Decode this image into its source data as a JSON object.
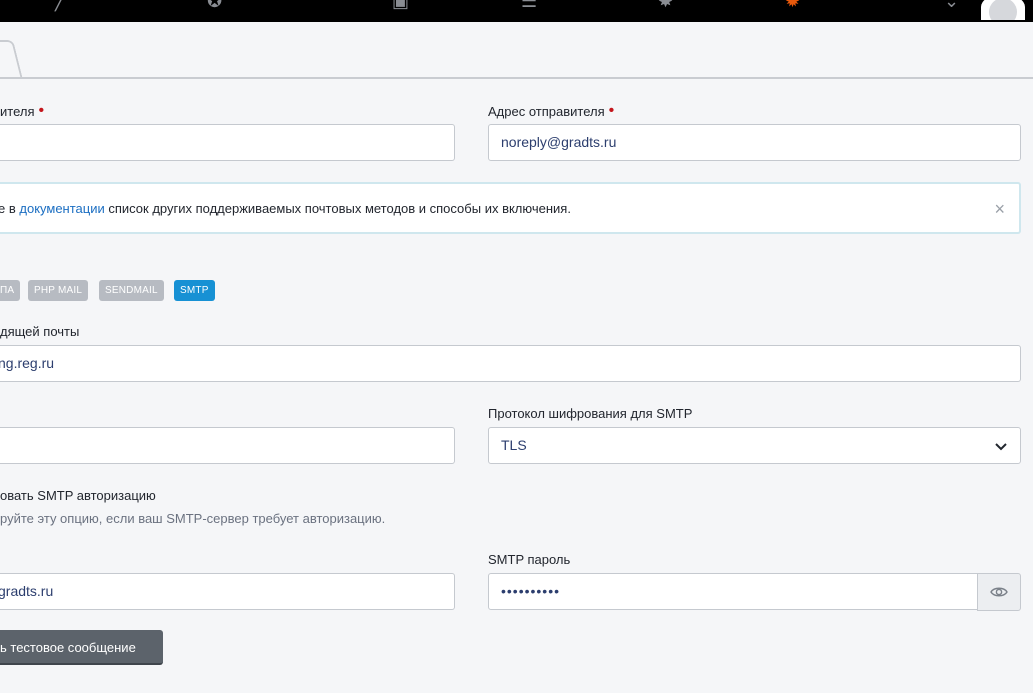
{
  "header": {
    "icons": [
      "back-icon",
      "rocket-icon",
      "calendar-icon",
      "list-icon",
      "puzzle-icon",
      "gear-icon",
      "user-avatar"
    ],
    "active_icon_color": "#e8590c"
  },
  "form": {
    "sender_name": {
      "label": "ителя",
      "value": ""
    },
    "sender_email": {
      "label": "Адрес отправителя",
      "value": "noreply@gradts.ru"
    },
    "alert": {
      "prefix": "е в ",
      "link": "документации",
      "suffix": " список других поддерживаемых почтовых методов и способы их включения.",
      "close": "×"
    },
    "mail_methods": [
      "ПА",
      "PHP MAIL",
      "SENDMAIL",
      "SMTP"
    ],
    "active_method": "SMTP",
    "smtp_host": {
      "label": "дящей почты",
      "value": "ng.reg.ru"
    },
    "smtp_port": {
      "label": "",
      "value": ""
    },
    "smtp_encryption": {
      "label": "Протокол шифрования для SMTP",
      "value": "TLS"
    },
    "smtp_auth": {
      "label": "овать SMTP авторизацию",
      "help": "руйте эту опцию, если ваш SMTP-сервер требует авторизацию."
    },
    "smtp_username": {
      "label": "",
      "value": "gradts.ru"
    },
    "smtp_password": {
      "label": "SMTP пароль",
      "value": "••••••••••"
    },
    "test_button": "ь тестовое сообщение"
  },
  "colors": {
    "accent": "#1791d4",
    "link": "#1b6ec2",
    "required": "#c4161c"
  }
}
